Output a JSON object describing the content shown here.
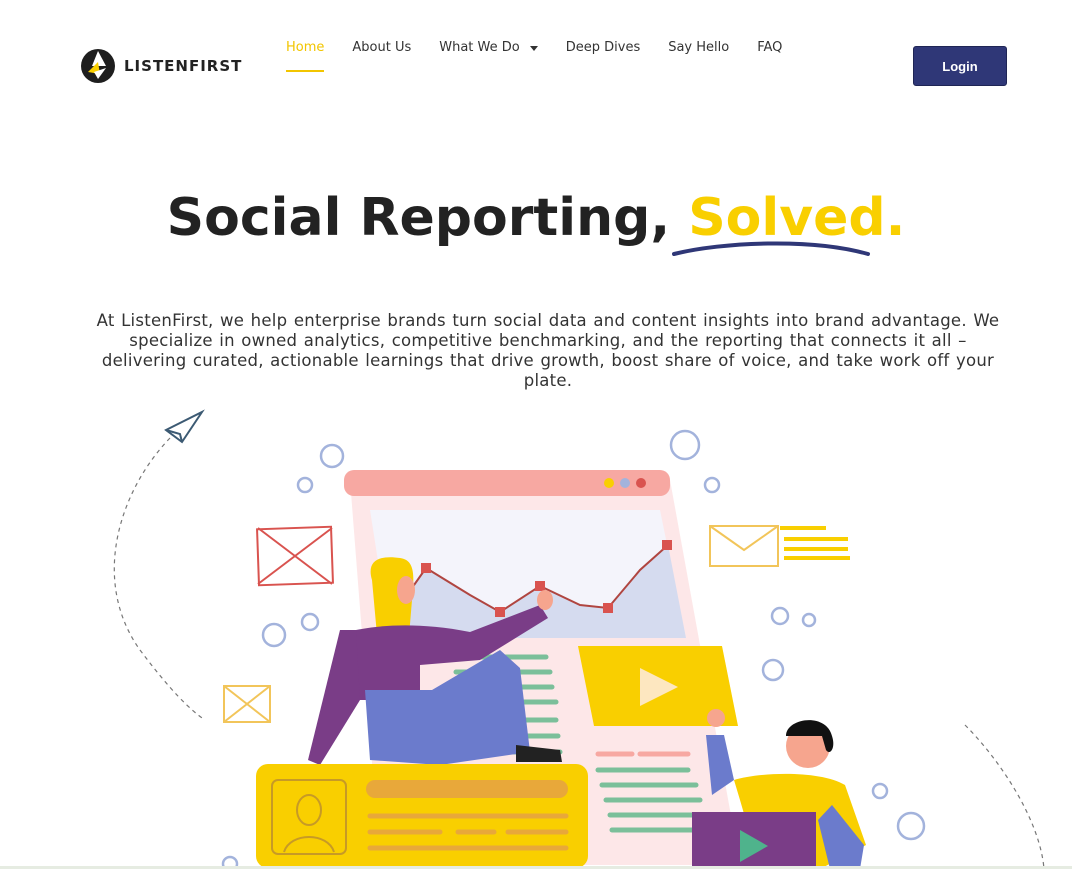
{
  "brand": {
    "name": "LISTENFIRST",
    "logo_icon": "listenfirst-logo-icon"
  },
  "nav": {
    "items": [
      {
        "label": "Home",
        "active": true
      },
      {
        "label": "About Us"
      },
      {
        "label": "What We Do",
        "has_dropdown": true
      },
      {
        "label": "Deep Dives"
      },
      {
        "label": "Say Hello"
      },
      {
        "label": "FAQ"
      }
    ],
    "login_label": "Login"
  },
  "hero": {
    "title_main": "Social Reporting,",
    "title_highlight": "Solved.",
    "description": "At ListenFirst, we help enterprise brands turn social data and content insights into brand advantage. We specialize in owned analytics, competitive benchmarking, and the reporting that connects it all – delivering curated, actionable learnings that drive growth, boost share of voice, and take work off your plate."
  },
  "colors": {
    "accent_yellow": "#f9cf00",
    "login_bg": "#2f3777",
    "underline": "#2f3777",
    "text": "#222222"
  }
}
